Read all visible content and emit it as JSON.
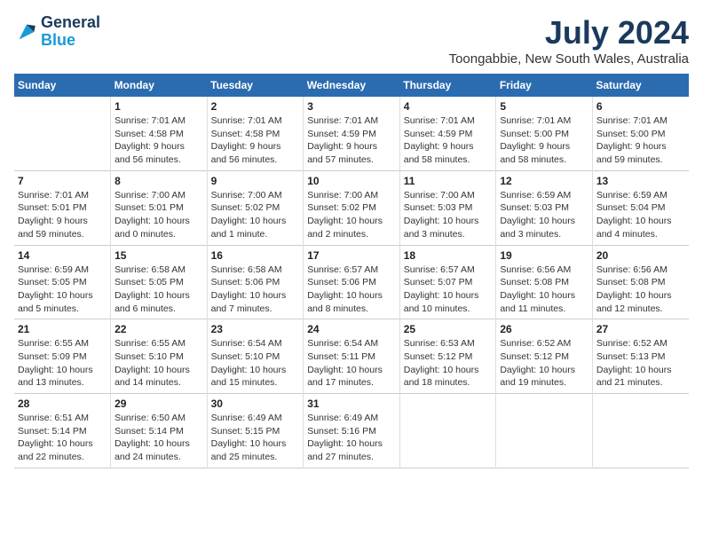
{
  "header": {
    "logo_line1": "General",
    "logo_line2": "Blue",
    "month": "July 2024",
    "location": "Toongabbie, New South Wales, Australia"
  },
  "weekdays": [
    "Sunday",
    "Monday",
    "Tuesday",
    "Wednesday",
    "Thursday",
    "Friday",
    "Saturday"
  ],
  "weeks": [
    [
      {
        "day": "",
        "info": ""
      },
      {
        "day": "1",
        "info": "Sunrise: 7:01 AM\nSunset: 4:58 PM\nDaylight: 9 hours\nand 56 minutes."
      },
      {
        "day": "2",
        "info": "Sunrise: 7:01 AM\nSunset: 4:58 PM\nDaylight: 9 hours\nand 56 minutes."
      },
      {
        "day": "3",
        "info": "Sunrise: 7:01 AM\nSunset: 4:59 PM\nDaylight: 9 hours\nand 57 minutes."
      },
      {
        "day": "4",
        "info": "Sunrise: 7:01 AM\nSunset: 4:59 PM\nDaylight: 9 hours\nand 58 minutes."
      },
      {
        "day": "5",
        "info": "Sunrise: 7:01 AM\nSunset: 5:00 PM\nDaylight: 9 hours\nand 58 minutes."
      },
      {
        "day": "6",
        "info": "Sunrise: 7:01 AM\nSunset: 5:00 PM\nDaylight: 9 hours\nand 59 minutes."
      }
    ],
    [
      {
        "day": "7",
        "info": "Sunrise: 7:01 AM\nSunset: 5:01 PM\nDaylight: 9 hours\nand 59 minutes."
      },
      {
        "day": "8",
        "info": "Sunrise: 7:00 AM\nSunset: 5:01 PM\nDaylight: 10 hours\nand 0 minutes."
      },
      {
        "day": "9",
        "info": "Sunrise: 7:00 AM\nSunset: 5:02 PM\nDaylight: 10 hours\nand 1 minute."
      },
      {
        "day": "10",
        "info": "Sunrise: 7:00 AM\nSunset: 5:02 PM\nDaylight: 10 hours\nand 2 minutes."
      },
      {
        "day": "11",
        "info": "Sunrise: 7:00 AM\nSunset: 5:03 PM\nDaylight: 10 hours\nand 3 minutes."
      },
      {
        "day": "12",
        "info": "Sunrise: 6:59 AM\nSunset: 5:03 PM\nDaylight: 10 hours\nand 3 minutes."
      },
      {
        "day": "13",
        "info": "Sunrise: 6:59 AM\nSunset: 5:04 PM\nDaylight: 10 hours\nand 4 minutes."
      }
    ],
    [
      {
        "day": "14",
        "info": "Sunrise: 6:59 AM\nSunset: 5:05 PM\nDaylight: 10 hours\nand 5 minutes."
      },
      {
        "day": "15",
        "info": "Sunrise: 6:58 AM\nSunset: 5:05 PM\nDaylight: 10 hours\nand 6 minutes."
      },
      {
        "day": "16",
        "info": "Sunrise: 6:58 AM\nSunset: 5:06 PM\nDaylight: 10 hours\nand 7 minutes."
      },
      {
        "day": "17",
        "info": "Sunrise: 6:57 AM\nSunset: 5:06 PM\nDaylight: 10 hours\nand 8 minutes."
      },
      {
        "day": "18",
        "info": "Sunrise: 6:57 AM\nSunset: 5:07 PM\nDaylight: 10 hours\nand 10 minutes."
      },
      {
        "day": "19",
        "info": "Sunrise: 6:56 AM\nSunset: 5:08 PM\nDaylight: 10 hours\nand 11 minutes."
      },
      {
        "day": "20",
        "info": "Sunrise: 6:56 AM\nSunset: 5:08 PM\nDaylight: 10 hours\nand 12 minutes."
      }
    ],
    [
      {
        "day": "21",
        "info": "Sunrise: 6:55 AM\nSunset: 5:09 PM\nDaylight: 10 hours\nand 13 minutes."
      },
      {
        "day": "22",
        "info": "Sunrise: 6:55 AM\nSunset: 5:10 PM\nDaylight: 10 hours\nand 14 minutes."
      },
      {
        "day": "23",
        "info": "Sunrise: 6:54 AM\nSunset: 5:10 PM\nDaylight: 10 hours\nand 15 minutes."
      },
      {
        "day": "24",
        "info": "Sunrise: 6:54 AM\nSunset: 5:11 PM\nDaylight: 10 hours\nand 17 minutes."
      },
      {
        "day": "25",
        "info": "Sunrise: 6:53 AM\nSunset: 5:12 PM\nDaylight: 10 hours\nand 18 minutes."
      },
      {
        "day": "26",
        "info": "Sunrise: 6:52 AM\nSunset: 5:12 PM\nDaylight: 10 hours\nand 19 minutes."
      },
      {
        "day": "27",
        "info": "Sunrise: 6:52 AM\nSunset: 5:13 PM\nDaylight: 10 hours\nand 21 minutes."
      }
    ],
    [
      {
        "day": "28",
        "info": "Sunrise: 6:51 AM\nSunset: 5:14 PM\nDaylight: 10 hours\nand 22 minutes."
      },
      {
        "day": "29",
        "info": "Sunrise: 6:50 AM\nSunset: 5:14 PM\nDaylight: 10 hours\nand 24 minutes."
      },
      {
        "day": "30",
        "info": "Sunrise: 6:49 AM\nSunset: 5:15 PM\nDaylight: 10 hours\nand 25 minutes."
      },
      {
        "day": "31",
        "info": "Sunrise: 6:49 AM\nSunset: 5:16 PM\nDaylight: 10 hours\nand 27 minutes."
      },
      {
        "day": "",
        "info": ""
      },
      {
        "day": "",
        "info": ""
      },
      {
        "day": "",
        "info": ""
      }
    ]
  ]
}
